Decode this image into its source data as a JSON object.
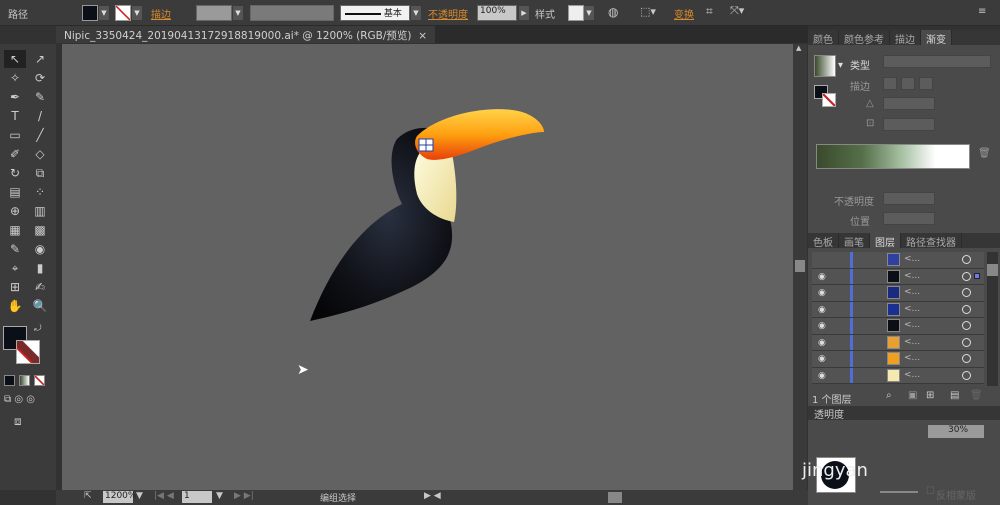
{
  "control_bar": {
    "object_type": "路径",
    "stroke_label": "描边",
    "stroke_style": "基本",
    "opacity_label": "不透明度",
    "opacity_value": "100%",
    "style_label": "样式",
    "transform_label": "变换"
  },
  "document_tab": {
    "title": "Nipic_3350424_20190413172918819000.ai* @ 1200% (RGB/预览)",
    "close": "×"
  },
  "tools": [
    "↖",
    "↗",
    "✧",
    "⟳",
    "✒",
    "✎",
    "T",
    "/",
    "▭",
    "╱",
    "✐",
    "◇",
    "↻",
    "⧉",
    "▤",
    "⁘",
    "⊕",
    "▥",
    "▦",
    "▩",
    "✎",
    "◉",
    "⌖",
    "▮",
    "⊞",
    "✍",
    "✋",
    "🔍"
  ],
  "status_bar": {
    "zoom": "1200%",
    "page": "1",
    "mode": "编组选择"
  },
  "gradient_panel": {
    "tabs": [
      "颜色",
      "颜色参考",
      "描边",
      "渐变"
    ],
    "active": 3,
    "type_label": "类型",
    "stroke_label": "描边",
    "opacity_label": "不透明度",
    "position_label": "位置",
    "colors": [
      "#3a4a2c",
      "#6e8a60",
      "#ffffff"
    ]
  },
  "layers_panel": {
    "tabs": [
      "色板",
      "画笔",
      "图层",
      "路径查找器"
    ],
    "active": 2,
    "layer_count": "1 个图层",
    "rows": [
      {
        "name": "<...",
        "visible": false,
        "thumb": "#3040a0"
      },
      {
        "name": "<...",
        "visible": true,
        "thumb": "#0b0e14",
        "selected": true
      },
      {
        "name": "<...",
        "visible": true,
        "thumb": "#1a2a80"
      },
      {
        "name": "<...",
        "visible": true,
        "thumb": "#1a3090"
      },
      {
        "name": "<...",
        "visible": true,
        "thumb": "#0b0e14"
      },
      {
        "name": "<...",
        "visible": true,
        "thumb": "#e8a030"
      },
      {
        "name": "<...",
        "visible": true,
        "thumb": "#f0a020"
      },
      {
        "name": "<...",
        "visible": true,
        "thumb": "#f5e8b0"
      }
    ]
  },
  "transparency_panel": {
    "title": "透明度",
    "opacity": "30%",
    "invert_mask": "反相蒙版",
    "watermark": "jingyan"
  }
}
